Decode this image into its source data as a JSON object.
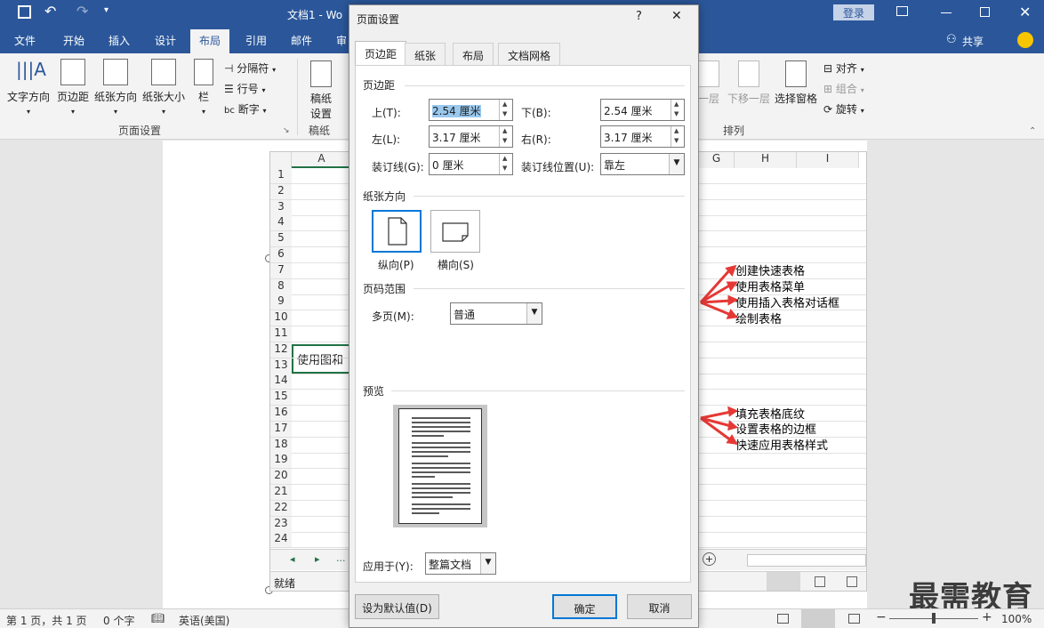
{
  "window": {
    "doc_title": "文档1 - Wo",
    "login": "登录",
    "share": "共享"
  },
  "tabs": [
    "文件",
    "开始",
    "插入",
    "设计",
    "布局",
    "引用",
    "邮件",
    "审"
  ],
  "ribbon": {
    "buttons": [
      "文字方向",
      "页边距",
      "纸张方向",
      "纸张大小",
      "栏"
    ],
    "small": [
      "分隔符",
      "行号",
      "断字"
    ],
    "draft": "稿纸\n设置",
    "group_page_setup": "页面设置",
    "group_draft": "稿纸",
    "arrange_buttons": [
      "一层",
      "下移一层",
      "选择窗格"
    ],
    "arrange_small": [
      "对齐",
      "组合",
      "旋转"
    ],
    "group_arrange": "排列"
  },
  "sheet": {
    "cols": [
      "A",
      "G",
      "H",
      "I"
    ],
    "rows": [
      "1",
      "2",
      "3",
      "4",
      "5",
      "6",
      "7",
      "8",
      "9",
      "10",
      "11",
      "12",
      "13",
      "14",
      "15",
      "16",
      "17",
      "18",
      "19",
      "20",
      "21",
      "22",
      "23",
      "24"
    ],
    "cell_text": "使用图和",
    "status": "就绪",
    "nav": [
      "◂",
      "▸",
      "..."
    ]
  },
  "annotations": [
    "创建快速表格",
    "使用表格菜单",
    "使用插入表格对话框",
    "绘制表格",
    "填充表格底纹",
    "设置表格的边框",
    "快速应用表格样式"
  ],
  "statusbar": {
    "page": "第 1 页，共 1 页",
    "words": "0 个字",
    "lang": "英语(美国)",
    "zoom": "100%"
  },
  "watermark": "最需教育",
  "dialog": {
    "title": "页面设置",
    "help": "?",
    "close": "✕",
    "tabs": [
      "页边距",
      "纸张",
      "布局",
      "文档网格"
    ],
    "margins_section": "页边距",
    "top_label": "上(T):",
    "top_value": "2.54 厘米",
    "bottom_label": "下(B):",
    "bottom_value": "2.54 厘米",
    "left_label": "左(L):",
    "left_value": "3.17 厘米",
    "right_label": "右(R):",
    "right_value": "3.17 厘米",
    "gutter_label": "装订线(G):",
    "gutter_value": "0 厘米",
    "gutter_pos_label": "装订线位置(U):",
    "gutter_pos_value": "靠左",
    "orientation_section": "纸张方向",
    "portrait": "纵向(P)",
    "landscape": "横向(S)",
    "pages_section": "页码范围",
    "multi_label": "多页(M):",
    "multi_value": "普通",
    "preview_section": "预览",
    "apply_label": "应用于(Y):",
    "apply_value": "整篇文档",
    "default_btn": "设为默认值(D)",
    "ok_btn": "确定",
    "cancel_btn": "取消"
  }
}
